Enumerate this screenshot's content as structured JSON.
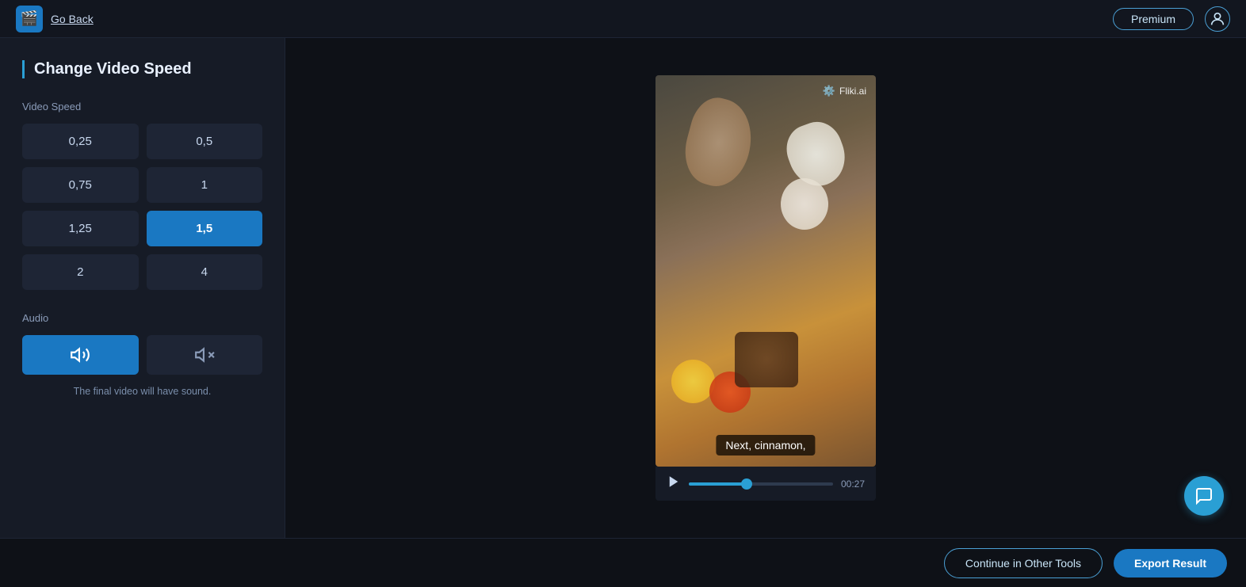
{
  "header": {
    "logo_icon": "🎬",
    "go_back_label": "Go Back",
    "premium_label": "Premium",
    "user_icon": "person"
  },
  "left_panel": {
    "title": "Change Video Speed",
    "speed_section_label": "Video Speed",
    "speed_options": [
      {
        "value": "0,25",
        "active": false
      },
      {
        "value": "0,5",
        "active": false
      },
      {
        "value": "0,75",
        "active": false
      },
      {
        "value": "1",
        "active": false
      },
      {
        "value": "1,25",
        "active": false
      },
      {
        "value": "1,5",
        "active": true
      },
      {
        "value": "2",
        "active": false
      },
      {
        "value": "4",
        "active": false
      }
    ],
    "audio_section_label": "Audio",
    "audio_options": [
      {
        "icon": "🔊",
        "active": true,
        "name": "sound-on"
      },
      {
        "icon": "🔇",
        "active": false,
        "name": "sound-off"
      }
    ],
    "audio_note": "The final video will have sound."
  },
  "video": {
    "watermark": "Fliki.ai",
    "subtitle": "Next, cinnamon,",
    "time": "00:27",
    "progress_percent": 40
  },
  "bottom_bar": {
    "continue_label": "Continue in Other Tools",
    "export_label": "Export Result"
  },
  "chat_icon": "💬"
}
